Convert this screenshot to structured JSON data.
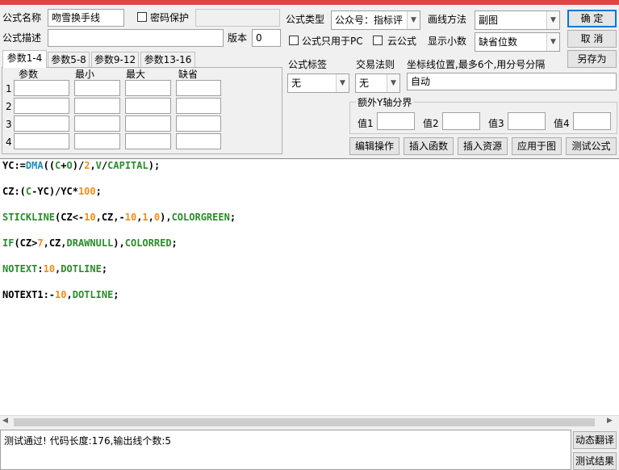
{
  "form": {
    "name_label": "公式名称",
    "name_value": "吻雪换手线",
    "password_label": "密码保护",
    "desc_label": "公式描述",
    "version_label": "版本",
    "version_value": "0",
    "type_label": "公式类型",
    "type_value": "公众号：指标评",
    "draw_label": "画线方法",
    "draw_value": "副图",
    "pc_only_label": "公式只用于PC",
    "cloud_label": "云公式",
    "decimal_label": "显示小数",
    "decimal_value": "缺省位数",
    "tag_label": "公式标签",
    "tag_value": "无",
    "trade_label": "交易法则",
    "trade_value": "无",
    "coord_label": "坐标线位置,最多6个,用分号分隔",
    "coord_value": "自动",
    "yaxis_label": "额外Y轴分界",
    "yaxis_values": [
      "值1",
      "值2",
      "值3",
      "值4"
    ]
  },
  "buttons": {
    "ok": "确  定",
    "cancel": "取  消",
    "save_as": "另存为",
    "edit_ops": "编辑操作",
    "insert_func": "插入函数",
    "insert_res": "插入资源",
    "apply_chart": "应用于图",
    "test_formula": "测试公式",
    "dyn_translate": "动态翻译",
    "test_result": "测试结果"
  },
  "tabs": [
    "参数1-4",
    "参数5-8",
    "参数9-12",
    "参数13-16"
  ],
  "params": {
    "headers": [
      "参数",
      "最小",
      "最大",
      "缺省"
    ],
    "rows": [
      "1",
      "2",
      "3",
      "4"
    ]
  },
  "code": [
    [
      [
        "YC:=",
        "black"
      ],
      [
        "DMA",
        "teal"
      ],
      [
        "((",
        "black"
      ],
      [
        "C",
        "green"
      ],
      [
        "+",
        "black"
      ],
      [
        "O",
        "green"
      ],
      [
        ")/",
        "black"
      ],
      [
        "2",
        "orange"
      ],
      [
        ",",
        "black"
      ],
      [
        "V",
        "green"
      ],
      [
        "/",
        "black"
      ],
      [
        "CAPITAL",
        "green"
      ],
      [
        ");",
        "black"
      ]
    ],
    [
      [
        "CZ:(",
        "black"
      ],
      [
        "C",
        "green"
      ],
      [
        "-YC)/YC*",
        "black"
      ],
      [
        "100",
        "orange"
      ],
      [
        ";",
        "black"
      ]
    ],
    [
      [
        "STICKLINE",
        "green"
      ],
      [
        "(CZ<-",
        "black"
      ],
      [
        "10",
        "orange"
      ],
      [
        ",CZ,-",
        "black"
      ],
      [
        "10",
        "orange"
      ],
      [
        ",",
        "black"
      ],
      [
        "1",
        "orange"
      ],
      [
        ",",
        "black"
      ],
      [
        "0",
        "orange"
      ],
      [
        "),",
        "black"
      ],
      [
        "COLORGREEN",
        "green"
      ],
      [
        ";",
        "black"
      ]
    ],
    [
      [
        "IF",
        "green"
      ],
      [
        "(CZ>",
        "black"
      ],
      [
        "7",
        "orange"
      ],
      [
        ",CZ,",
        "black"
      ],
      [
        "DRAWNULL",
        "green"
      ],
      [
        "),",
        "black"
      ],
      [
        "COLORRED",
        "green"
      ],
      [
        ";",
        "black"
      ]
    ],
    [
      [
        "NOTEXT",
        "green"
      ],
      [
        ":",
        "black"
      ],
      [
        "10",
        "orange"
      ],
      [
        ",",
        "black"
      ],
      [
        "DOTLINE",
        "green"
      ],
      [
        ";",
        "black"
      ]
    ],
    [
      [
        "NOTEXT1:-",
        "black"
      ],
      [
        "10",
        "orange"
      ],
      [
        ",",
        "black"
      ],
      [
        "DOTLINE",
        "green"
      ],
      [
        ";",
        "black"
      ]
    ]
  ],
  "status": "测试通过! 代码长度:176,输出线个数:5"
}
